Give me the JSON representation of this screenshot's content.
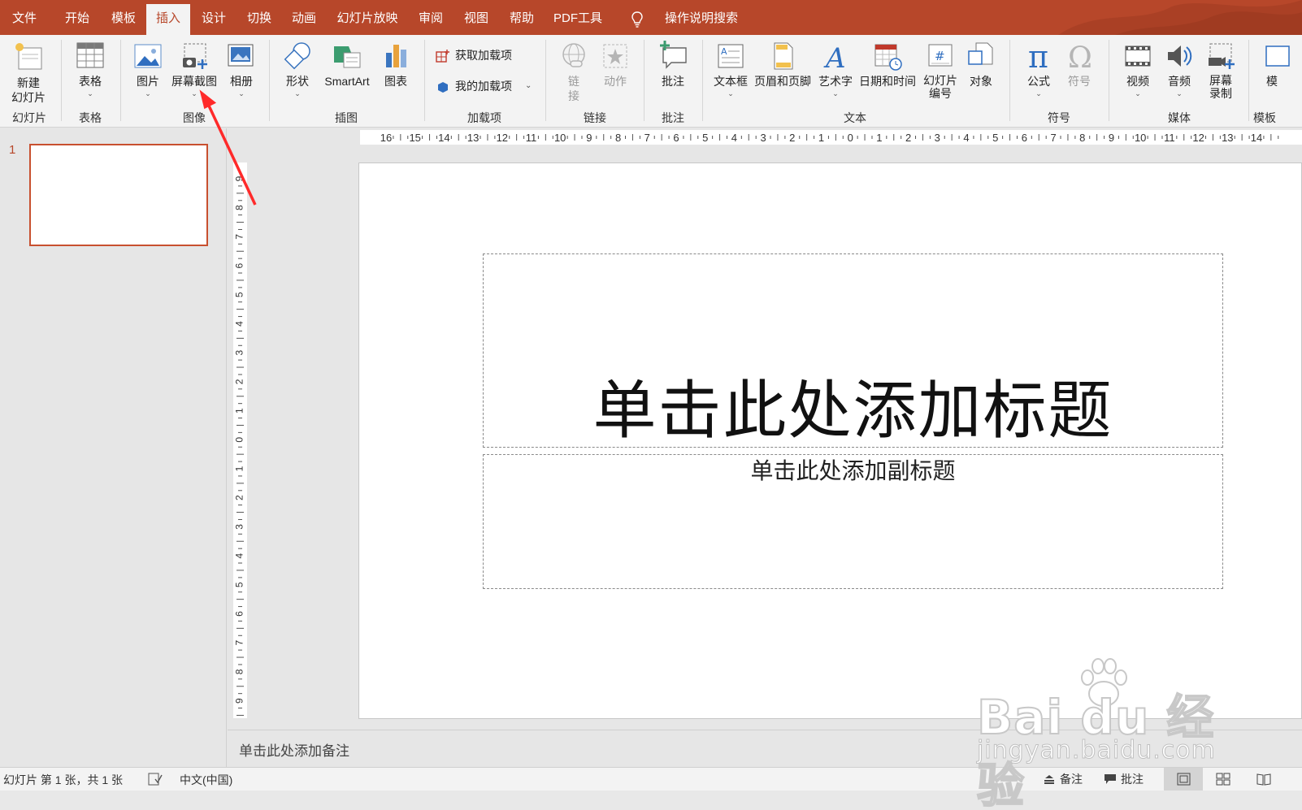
{
  "tabs": [
    "文件",
    "开始",
    "模板",
    "插入",
    "设计",
    "切换",
    "动画",
    "幻灯片放映",
    "审阅",
    "视图",
    "帮助",
    "PDF工具"
  ],
  "active_tab": "插入",
  "search_label": "操作说明搜索",
  "ribbon": {
    "new_slide": {
      "line1": "新建",
      "line2": "幻灯片"
    },
    "table": "表格",
    "picture": "图片",
    "screenshot": "屏幕截图",
    "album": "相册",
    "shapes": "形状",
    "smartart": "SmartArt",
    "chart": "图表",
    "get_addins": "获取加载项",
    "my_addins": "我的加载项",
    "link": {
      "line1": "链",
      "line2": "接"
    },
    "action": "动作",
    "comment": "批注",
    "textbox": "文本框",
    "header_footer": "页眉和页脚",
    "wordart": "艺术字",
    "datetime": "日期和时间",
    "slide_number": {
      "line1": "幻灯片",
      "line2": "编号"
    },
    "object": "对象",
    "equation": "公式",
    "symbol": "符号",
    "video": "视频",
    "audio": "音频",
    "screen_record": {
      "line1": "屏幕",
      "line2": "录制"
    },
    "template_cut": "模",
    "groups": {
      "slides": "幻灯片",
      "tables": "表格",
      "images": "图像",
      "illustrations": "插图",
      "addins": "加载项",
      "links": "链接",
      "comments": "批注",
      "text": "文本",
      "symbols": "符号",
      "media": "媒体",
      "templates": "模板"
    }
  },
  "hruler_labels": [
    "16",
    "15",
    "14",
    "13",
    "12",
    "11",
    "10",
    "9",
    "8",
    "7",
    "6",
    "5",
    "4",
    "3",
    "2",
    "1",
    "0",
    "1",
    "2",
    "3",
    "4",
    "5",
    "6",
    "7",
    "8",
    "9",
    "10",
    "11",
    "12",
    "13",
    "14"
  ],
  "vruler_labels": [
    "9",
    "8",
    "7",
    "6",
    "5",
    "4",
    "3",
    "2",
    "1",
    "0",
    "1",
    "2",
    "3",
    "4",
    "5",
    "6",
    "7",
    "8",
    "9"
  ],
  "thumbnail": {
    "number": "1"
  },
  "slide": {
    "title_placeholder": "单击此处添加标题",
    "subtitle_placeholder": "单击此处添加副标题"
  },
  "notes_placeholder": "单击此处添加备注",
  "status": {
    "slide_info": "幻灯片 第 1 张，共 1 张",
    "language": "中文(中国)",
    "notes_btn": "备注",
    "comments_btn": "批注"
  },
  "watermark": {
    "top": "Bai  du 经验",
    "bottom": "jingyan.baidu.com"
  },
  "colors": {
    "accent": "#b7472a",
    "ribbon_bg": "#f3f3f3",
    "annotation_arrow": "#ff2a2a"
  }
}
